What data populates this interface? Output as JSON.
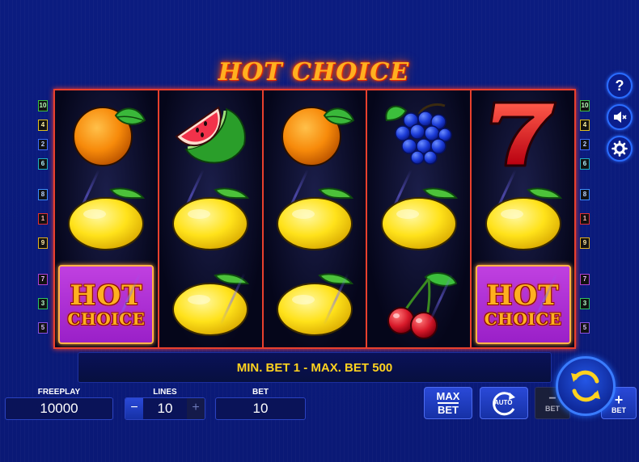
{
  "game": {
    "title": "HOT CHOICE"
  },
  "hot_tile": {
    "line1": "HOT",
    "line2": "CHOICE"
  },
  "reels": [
    [
      "orange",
      "lemon",
      "hot-choice"
    ],
    [
      "watermelon",
      "lemon",
      "lemon"
    ],
    [
      "orange",
      "lemon",
      "lemon"
    ],
    [
      "grapes",
      "lemon",
      "cherries"
    ],
    [
      "seven",
      "lemon",
      "hot-choice"
    ]
  ],
  "paylines": {
    "left": [
      "10",
      "4",
      "2",
      "6",
      "8",
      "1",
      "9",
      "7",
      "3",
      "5"
    ],
    "right": [
      "10",
      "4",
      "2",
      "6",
      "8",
      "1",
      "9",
      "7",
      "3",
      "5"
    ],
    "colors": {
      "10": "#3fbf3f",
      "4": "#e0c020",
      "2": "#3a6cff",
      "6": "#20b0c0",
      "8": "#3a8cff",
      "1": "#e03030",
      "9": "#e0b020",
      "7": "#b040d0",
      "3": "#30c060",
      "5": "#8a50e0"
    }
  },
  "message": "MIN. BET 1 - MAX. BET 500",
  "freeplay": {
    "label": "FREEPLAY",
    "value": "10000"
  },
  "lines": {
    "label": "LINES",
    "value": "10",
    "minus": "−",
    "plus": "+"
  },
  "bet": {
    "label": "BET",
    "value": "10"
  },
  "buttons": {
    "max_bet_line1": "MAX",
    "max_bet_line2": "BET",
    "auto": "AUTO",
    "bet_minus_sign": "−",
    "bet_minus_label": "BET",
    "bet_plus_sign": "+",
    "bet_plus_label": "BET"
  },
  "side_icons": [
    "help-icon",
    "sound-off-icon",
    "settings-icon"
  ],
  "colors": {
    "background": "#0a1a7a",
    "frame": "#e8402d",
    "title": "#ffb020",
    "message": "#ffd21f",
    "button": "#2a49d8"
  }
}
